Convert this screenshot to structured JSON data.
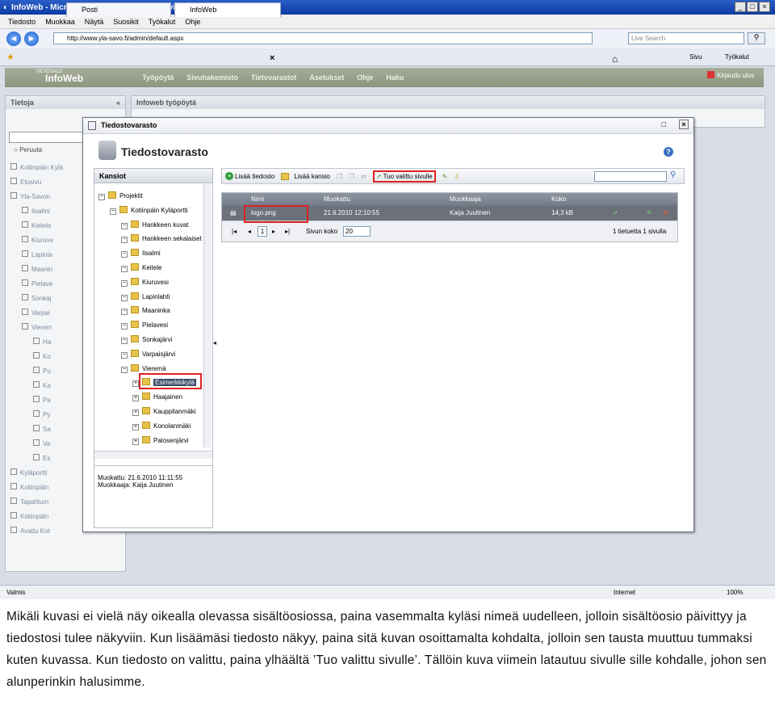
{
  "browser": {
    "window_title": "InfoWeb - Microsoft Internet Explorer provided by Vieremän kunta",
    "menu": [
      "Tiedosto",
      "Muokkaa",
      "Näytä",
      "Suosikit",
      "Työkalut",
      "Ohje"
    ],
    "address": "http://www.yla-savo.fi/admin/default.aspx",
    "search_placeholder": "Live Search",
    "tabs": [
      "Posti",
      "InfoWeb"
    ],
    "tools": [
      "Sivu",
      "Työkalut"
    ],
    "status_left": "Valmis",
    "status_zone": "Internet",
    "status_zoom": "100%"
  },
  "app": {
    "logo_small": "TIETOTALO",
    "logo": "InfoWeb",
    "nav": [
      "Työpöytä",
      "Sivuhakemisto",
      "Tietovarastot",
      "Asetukset",
      "Ohje",
      "Haku"
    ],
    "logout": "Kirjaudu ulos",
    "side_title": "Tietoja",
    "side_collapse": "«",
    "side_option": "Peruuta",
    "work_title": "Infoweb työpöytä",
    "side_items": [
      "Kotiinpäin Kylä",
      "Etusivu",
      "Yla-Savon",
      "Iisalmi",
      "Keitele",
      "Kiuruve",
      "Lapinla",
      "Maanin",
      "Pielave",
      "Sonkaj",
      "Varpai",
      "Vierem",
      "Ha",
      "Ko",
      "Pu",
      "Ka",
      "Pa",
      "Py",
      "Sa",
      "Va",
      "Es",
      "Kyläportti",
      "Kotiinpäin",
      "Tapahtum",
      "Kotiinpäin",
      "Avattu Kot"
    ]
  },
  "modal": {
    "title": "Tiedostovarasto",
    "heading": "Tiedostovarasto",
    "help": "?",
    "folders_header": "Kansiot",
    "tree": [
      {
        "label": "Projektit",
        "level": 0
      },
      {
        "label": "Kotiinpäin Kyläportti",
        "level": 1
      },
      {
        "label": "Hankkeen kuvat",
        "level": 2
      },
      {
        "label": "Hankkeen sekalaiset",
        "level": 2
      },
      {
        "label": "Iisalmi",
        "level": 2
      },
      {
        "label": "Keitele",
        "level": 2
      },
      {
        "label": "Kiuruvesi",
        "level": 2
      },
      {
        "label": "Lapinlahti",
        "level": 2
      },
      {
        "label": "Maaninka",
        "level": 2
      },
      {
        "label": "Pielavesi",
        "level": 2
      },
      {
        "label": "Sonkajärvi",
        "level": 2
      },
      {
        "label": "Varpaisjärvi",
        "level": 2
      },
      {
        "label": "Vieremä",
        "level": 2
      },
      {
        "label": "Esimerkkikylä",
        "level": 3
      },
      {
        "label": "Haajainen",
        "level": 3
      },
      {
        "label": "Kauppilanmäki",
        "level": 3
      },
      {
        "label": "Konolanmäki",
        "level": 3
      },
      {
        "label": "Palosenjärvi",
        "level": 3
      }
    ],
    "info_modified": "Muokattu: 21.6.2010 11:11:55",
    "info_editor": "Muokkaaja: Kaija Juutinen",
    "toolbar": {
      "add_file": "Lisää tiedosto",
      "add_folder": "Lisää kansio",
      "use_on_page": "Tuo valittu sivulle"
    },
    "grid": {
      "columns": [
        "Nimi",
        "Muokattu",
        "Muokkaaja",
        "Koko"
      ],
      "rows": [
        {
          "name": "logo.png",
          "modified": "21.6.2010 12:10:55",
          "editor": "Kaija Juutinen",
          "size": "14,3 kB"
        }
      ],
      "page": "1",
      "page_size_label": "Sivun koko",
      "page_size": "20",
      "summary": "1 tietuetta 1 sivulla"
    }
  },
  "caption": [
    "Mikäli kuvasi ei vielä näy oikealla olevassa sisältöosiossa, paina vasemmalta kyläsi nimeä uudelleen, jolloin sisältöosio päivittyy ja tiedostosi tulee näkyviin. Kun lisäämäsi tiedosto näkyy, paina sitä kuvan osoittamalta kohdalta, jolloin sen tausta muuttuu tummaksi kuten kuvassa. Kun tiedosto on valittu, paina ylhäältä ’Tuo valittu sivulle’. Tällöin kuva viimein latautuu sivulle sille kohdalle, johon sen alunperinkin halusimme."
  ]
}
